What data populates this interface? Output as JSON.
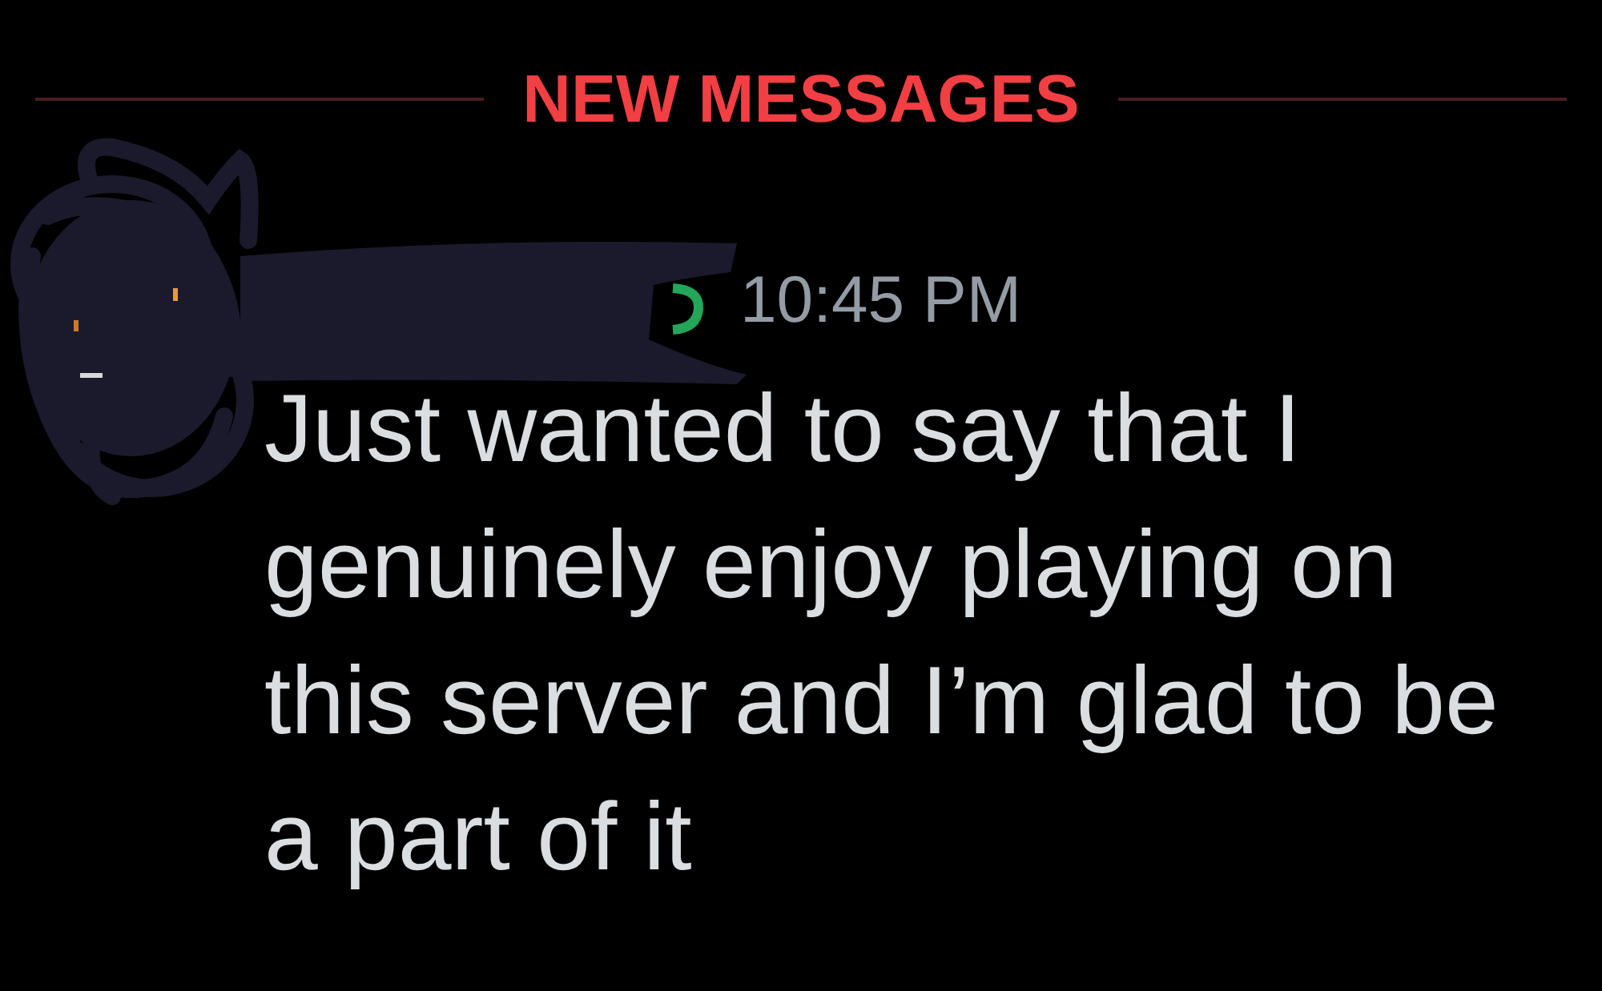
{
  "divider": {
    "label": "NEW MESSAGES"
  },
  "message": {
    "author": {
      "redacted": true
    },
    "timestamp": "10:45 PM",
    "text": "Just wanted to say that I genuinely enjoy playing on this server and I’m glad to be a part of it"
  }
}
